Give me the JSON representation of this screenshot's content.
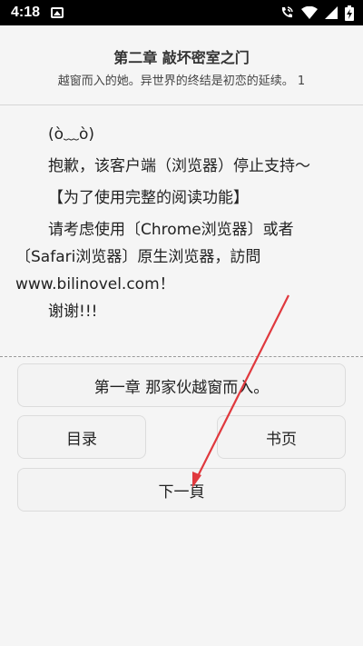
{
  "status_bar": {
    "time": "4:18",
    "icons": [
      "photo-icon",
      "call-wifi-icon",
      "wifi-icon",
      "signal-icon",
      "battery-charging-icon"
    ]
  },
  "header": {
    "title": "第二章 敲坏密室之门",
    "subtitle": "越窗而入的她。异世界的终结是初恋的延续。 1"
  },
  "content": {
    "lines": [
      "(ò﹏ò)",
      "抱歉，该客户端（浏览器）停止支持～",
      "【为了使用完整的阅读功能】",
      "请考虑使用〔Chrome浏览器〕或者〔Safari浏览器〕原生浏览器，訪問www.bilinovel.com！",
      "谢谢!!!"
    ]
  },
  "nav": {
    "prev_chapter": "第一章 那家伙越窗而入。",
    "toc": "目录",
    "bookmark": "书页",
    "next_page": "下一頁"
  },
  "colors": {
    "background": "#f5f5f5",
    "button_bg": "#f3f3f3",
    "annotation_arrow": "#e0393e"
  }
}
